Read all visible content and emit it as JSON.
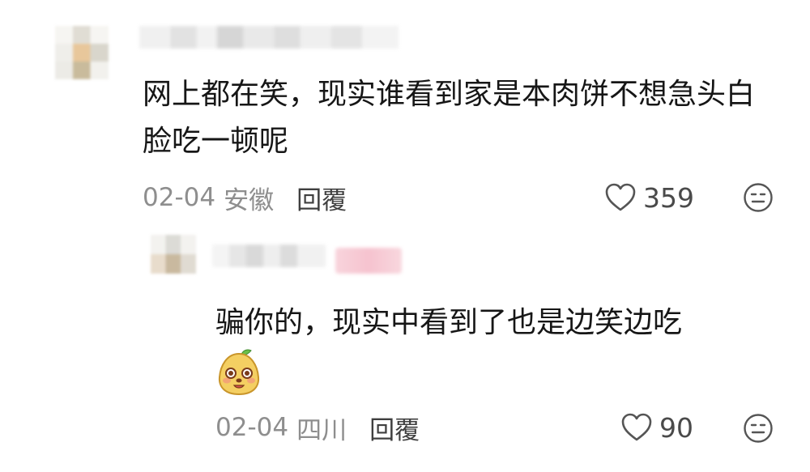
{
  "comments": [
    {
      "text": "网上都在笑，现实谁看到家是本肉饼不想急头白脸吃一顿呢",
      "date": "02-04",
      "location": "安徽",
      "reply_label": "回覆",
      "likes": "359",
      "icons": {
        "like": "heart-outline-icon",
        "dislike": "meh-face-icon"
      }
    },
    {
      "text": "骗你的，现实中看到了也是边笑边吃",
      "emoji": "cute-mascot-sticker",
      "date": "02-04",
      "location": "四川",
      "reply_label": "回覆",
      "likes": "90",
      "icons": {
        "like": "heart-outline-icon",
        "dislike": "meh-face-icon"
      }
    }
  ],
  "colors": {
    "text": "#161616",
    "meta": "#8e8e8e",
    "reply": "#3f3f3f",
    "icon": "#555555",
    "tag": "#f6c3cf"
  }
}
